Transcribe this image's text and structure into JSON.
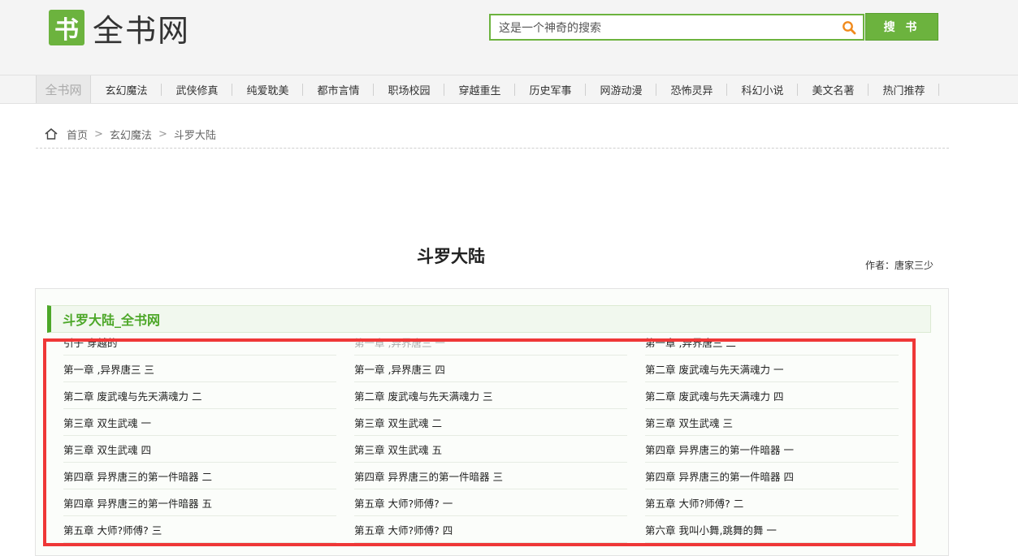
{
  "site": {
    "logo_mark": "书",
    "logo_text": "全书网"
  },
  "search": {
    "placeholder": "这是一个神奇的搜索",
    "button_label": "搜 书"
  },
  "nav": {
    "home_label": "全书网",
    "items": [
      "玄幻魔法",
      "武侠修真",
      "纯爱耽美",
      "都市言情",
      "职场校园",
      "穿越重生",
      "历史军事",
      "网游动漫",
      "恐怖灵异",
      "科幻小说",
      "美文名著",
      "热门推荐"
    ]
  },
  "breadcrumb": {
    "home": "首页",
    "sep1": ">",
    "category": "玄幻魔法",
    "sep2": ">",
    "book": "斗罗大陆"
  },
  "book": {
    "title": "斗罗大陆",
    "author": "作者：唐家三少"
  },
  "chapter_panel": {
    "heading": "斗罗大陆_全书网",
    "chapters": [
      "引子 穿越的",
      "第一章 ,异界唐三 一",
      "第一章 ,异界唐三 二",
      "第一章 ,异界唐三 三",
      "第一章 ,异界唐三 四",
      "第二章 废武魂与先天满魂力 一",
      "第二章 废武魂与先天满魂力 二",
      "第二章 废武魂与先天满魂力 三",
      "第二章 废武魂与先天满魂力 四",
      "第三章 双生武魂 一",
      "第三章 双生武魂 二",
      "第三章 双生武魂 三",
      "第三章 双生武魂 四",
      "第三章 双生武魂 五",
      "第四章 异界唐三的第一件暗器 一",
      "第四章 异界唐三的第一件暗器 二",
      "第四章 异界唐三的第一件暗器 三",
      "第四章 异界唐三的第一件暗器 四",
      "第四章 异界唐三的第一件暗器 五",
      "第五章 大师?师傅? 一",
      "第五章 大师?师傅? 二",
      "第五章 大师?师傅? 三",
      "第五章 大师?师傅? 四",
      "第六章 我叫小舞,跳舞的舞 一"
    ]
  },
  "colors": {
    "brand_green": "#6cb33e",
    "heading_green": "#4ca728",
    "highlight_red": "#ef3737"
  }
}
